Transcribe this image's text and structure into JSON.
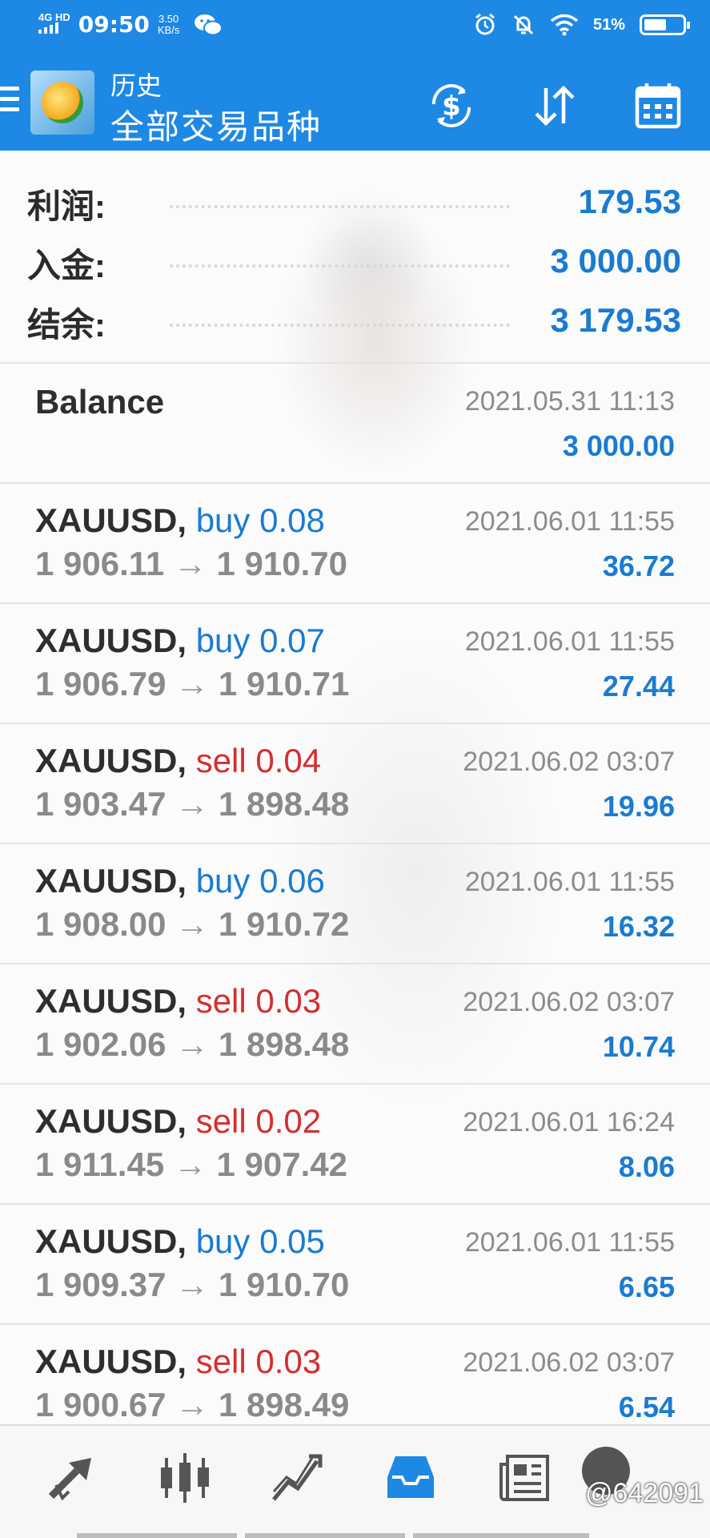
{
  "status_bar": {
    "network": "4G HD",
    "signal_icon": "signal-bars-icon",
    "time": "09:50",
    "speed_value": "3.50",
    "speed_unit": "KB/s",
    "wechat_icon": "wechat-icon",
    "alarm_icon": "alarm-icon",
    "mute_icon": "bell-off-icon",
    "wifi_icon": "wifi-icon",
    "battery_text": "51%",
    "battery_level": 0.51
  },
  "app_bar": {
    "title": "历史",
    "subtitle": "全部交易品种",
    "menu_icon": "hamburger-menu-icon",
    "logo": "metatrader-logo",
    "actions": [
      "dollar-sync-icon",
      "sort-arrows-icon",
      "calendar-icon"
    ]
  },
  "summary": {
    "profit_label": "利润:",
    "profit_value": "179.53",
    "deposit_label": "入金:",
    "deposit_value": "3 000.00",
    "balance_label": "结余:",
    "balance_value": "3 179.53"
  },
  "balance_entry": {
    "title": "Balance",
    "date": "2021.05.31 11:13",
    "amount": "3 000.00"
  },
  "trades": [
    {
      "symbol": "XAUUSD,",
      "side": "buy 0.08",
      "type": "buy",
      "open": "1 906.11",
      "arrow": "→",
      "close": "1 910.70",
      "date": "2021.06.01 11:55",
      "profit": "36.72"
    },
    {
      "symbol": "XAUUSD,",
      "side": "buy 0.07",
      "type": "buy",
      "open": "1 906.79",
      "arrow": "→",
      "close": "1 910.71",
      "date": "2021.06.01 11:55",
      "profit": "27.44"
    },
    {
      "symbol": "XAUUSD,",
      "side": "sell 0.04",
      "type": "sell",
      "open": "1 903.47",
      "arrow": "→",
      "close": "1 898.48",
      "date": "2021.06.02 03:07",
      "profit": "19.96"
    },
    {
      "symbol": "XAUUSD,",
      "side": "buy 0.06",
      "type": "buy",
      "open": "1 908.00",
      "arrow": "→",
      "close": "1 910.72",
      "date": "2021.06.01 11:55",
      "profit": "16.32"
    },
    {
      "symbol": "XAUUSD,",
      "side": "sell 0.03",
      "type": "sell",
      "open": "1 902.06",
      "arrow": "→",
      "close": "1 898.48",
      "date": "2021.06.02 03:07",
      "profit": "10.74"
    },
    {
      "symbol": "XAUUSD,",
      "side": "sell 0.02",
      "type": "sell",
      "open": "1 911.45",
      "arrow": "→",
      "close": "1 907.42",
      "date": "2021.06.01 16:24",
      "profit": "8.06"
    },
    {
      "symbol": "XAUUSD,",
      "side": "buy 0.05",
      "type": "buy",
      "open": "1 909.37",
      "arrow": "→",
      "close": "1 910.70",
      "date": "2021.06.01 11:55",
      "profit": "6.65"
    },
    {
      "symbol": "XAUUSD,",
      "side": "sell 0.03",
      "type": "sell",
      "open": "1 900.67",
      "arrow": "→",
      "close": "1 898.49",
      "date": "2021.06.02 03:07",
      "profit": "6.54"
    }
  ],
  "bottom_nav": {
    "items": [
      "quotes-arrows-icon",
      "candlestick-chart-icon",
      "trend-chart-icon",
      "inbox-tray-icon",
      "news-icon",
      "avatar-icon"
    ],
    "active": "inbox-tray-icon",
    "watermark": "@642091"
  },
  "colors": {
    "primary": "#1e88e5",
    "buy": "#1a7bd1",
    "sell": "#d32f2f",
    "muted": "#8a8a8a"
  }
}
